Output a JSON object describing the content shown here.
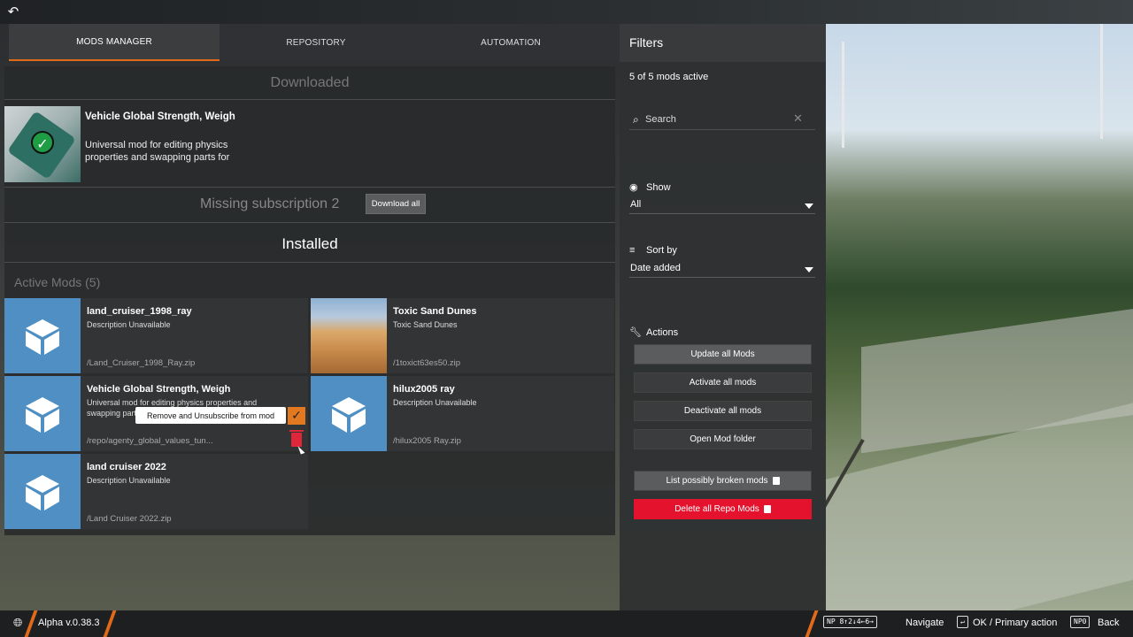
{
  "tabs": {
    "mods_manager": "MODS MANAGER",
    "repository": "REPOSITORY",
    "automation": "AUTOMATION"
  },
  "downloaded": {
    "title": "Downloaded",
    "mod": {
      "name": "Vehicle Global Strength, Weigh",
      "description": "Universal mod for editing physics properties and swapping parts for"
    },
    "missing_label": "Missing subscription 2",
    "download_all": "Download all"
  },
  "installed": {
    "title": "Installed",
    "active_title": "Active Mods (5)",
    "mods": [
      {
        "name": "land_cruiser_1998_ray",
        "description": "Description Unavailable",
        "path": "/Land_Cruiser_1998_Ray.zip"
      },
      {
        "name": "Toxic Sand Dunes",
        "description": "Toxic Sand Dunes",
        "path": "/1toxict63es50.zip"
      },
      {
        "name": "Vehicle Global Strength, Weigh",
        "description": "Universal mod for editing physics properties and swapping parts",
        "path": "/repo/agenty_global_values_tun..."
      },
      {
        "name": "hilux2005 ray",
        "description": "Description Unavailable",
        "path": "/hilux2005 Ray.zip"
      },
      {
        "name": "land cruiser 2022",
        "description": "Description Unavailable",
        "path": "/Land Cruiser 2022.zip"
      }
    ],
    "tooltip": "Remove and Unsubscribe from mod"
  },
  "filters": {
    "title": "Filters",
    "active_count": "5 of 5 mods active",
    "search_placeholder": "Search",
    "show_label": "Show",
    "show_value": "All",
    "sort_label": "Sort by",
    "sort_value": "Date added",
    "actions_label": "Actions",
    "buttons": {
      "update": "Update all Mods",
      "activate": "Activate all mods",
      "deactivate": "Deactivate all mods",
      "folder": "Open Mod folder",
      "broken": "List possibly broken mods",
      "delete": "Delete all Repo Mods"
    }
  },
  "bottom": {
    "version": "Alpha v.0.38.3",
    "navigate_key": "NP 8↑2↓4←6→",
    "navigate": "Navigate",
    "ok_key": "↵",
    "ok": "OK / Primary action",
    "back_key": "NP0",
    "back": "Back"
  },
  "colors": {
    "accent": "#e06a1a",
    "danger": "#e4122c",
    "mod_thumb": "#4f8fc4",
    "active": "#e2781f"
  },
  "icons": [
    "back-arrow-icon",
    "check-icon",
    "cube-icon",
    "search-icon",
    "close-icon",
    "eye-icon",
    "sort-icon",
    "wrench-icon",
    "trash-icon",
    "globe-icon"
  ]
}
